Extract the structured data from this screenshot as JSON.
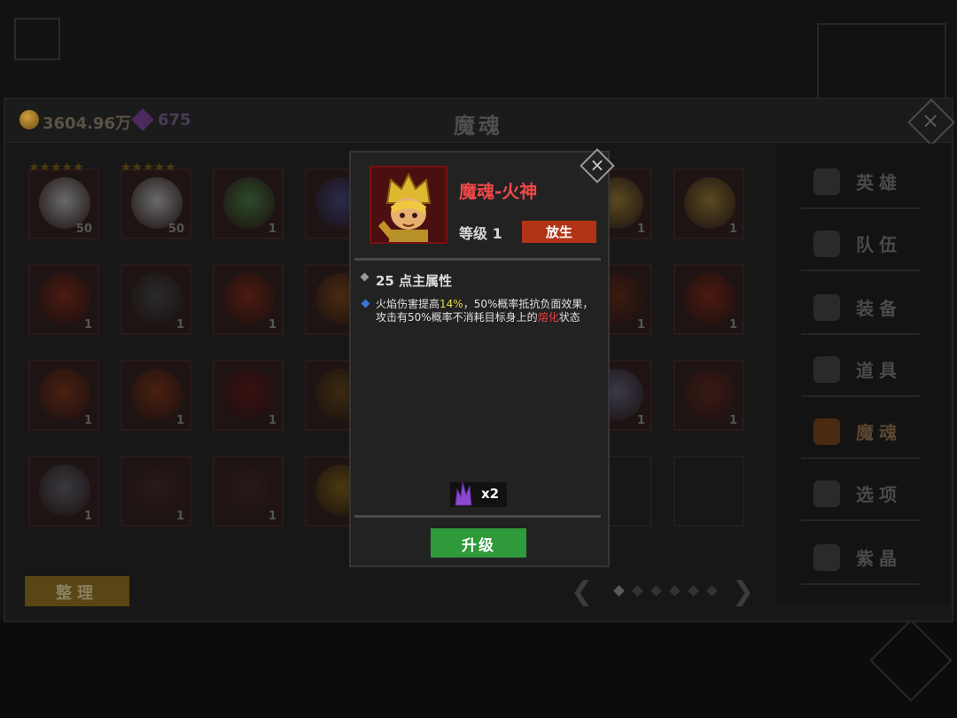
{
  "currency": {
    "gold": "3604.96万",
    "gems": "675"
  },
  "panel": {
    "title": "魔魂"
  },
  "grid": {
    "rows": [
      [
        {
          "stars": "★★★★★",
          "count": "50",
          "color": "#6a6a6a"
        },
        {
          "stars": "★★★★★",
          "count": "50",
          "color": "#6a6a6a"
        },
        {
          "count": "1",
          "color": "#2e4a2a"
        },
        {
          "count": "",
          "color": "#2a2a4a"
        },
        {
          "count": "1",
          "color": "#5a4a20"
        },
        {
          "count": "1",
          "color": "#5a4a20"
        }
      ],
      [
        {
          "count": "1",
          "color": "#4a1a10"
        },
        {
          "count": "1",
          "color": "#2a2a2a"
        },
        {
          "count": "1",
          "color": "#4a1a10"
        },
        {
          "count": "",
          "color": "#4a2a10"
        },
        {
          "count": "1",
          "color": "#3a1a10"
        },
        {
          "count": "1",
          "color": "#4a1a10"
        }
      ],
      [
        {
          "count": "1",
          "color": "#4a2010"
        },
        {
          "count": "1",
          "color": "#4a2010"
        },
        {
          "count": "1",
          "color": "#3a1010"
        },
        {
          "count": "",
          "color": "#3a2a10"
        },
        {
          "count": "1",
          "color": "#3a3a48"
        },
        {
          "count": "1",
          "color": "#3a1a14"
        }
      ],
      [
        {
          "count": "1",
          "color": "#3a3a40"
        },
        {
          "count": "1",
          "color": "#2a1a1a"
        },
        {
          "count": "1",
          "color": "#2a1a1a"
        },
        {
          "count": "",
          "color": "#4a3a10"
        }
      ]
    ]
  },
  "sidebar": {
    "items": [
      {
        "label": "英雄",
        "icon": "heroes-icon"
      },
      {
        "label": "队伍",
        "icon": "flag-icon"
      },
      {
        "label": "装备",
        "icon": "helmet-icon"
      },
      {
        "label": "道具",
        "icon": "bag-icon"
      },
      {
        "label": "魔魂",
        "icon": "flame-icon"
      },
      {
        "label": "选项",
        "icon": "gear-icon"
      },
      {
        "label": "紫晶",
        "icon": "crystal-icon"
      }
    ]
  },
  "actions": {
    "sort_label": "整理"
  },
  "dialog": {
    "name": "魔魂-火神",
    "level": "等级 1",
    "release_label": "放生",
    "attribute": "25 点主属性",
    "desc_a": "火焰伤害提高",
    "desc_pct": "14%",
    "desc_b": "，50%概率抵抗负面效果，",
    "desc_c": "攻击有50%概率不消耗目标身上的",
    "desc_melt": "熔化",
    "desc_d": "状态",
    "cost": "x2",
    "upgrade_label": "升级"
  },
  "colors": {
    "name_red": "#ef4848",
    "upgrade_green": "#2e9a3a",
    "release_red": "#b33316"
  }
}
